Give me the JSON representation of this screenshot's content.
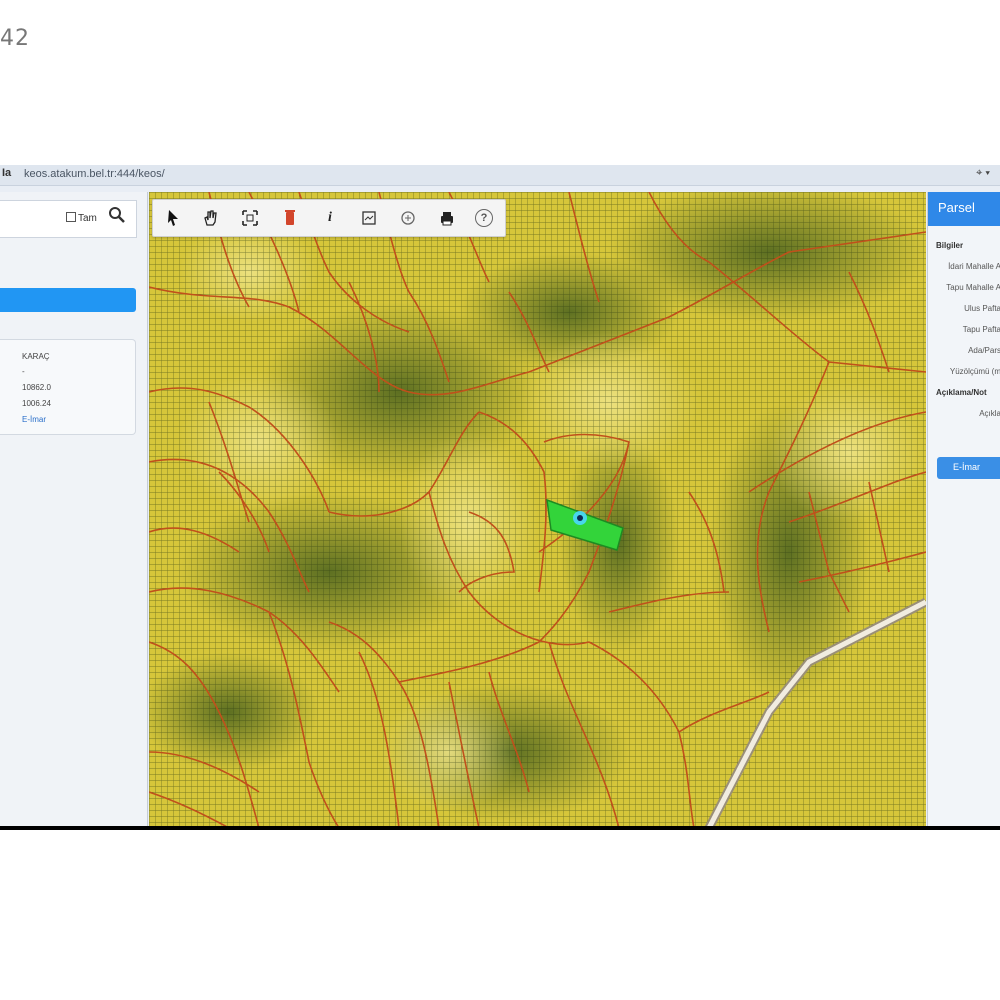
{
  "corner_number": "42",
  "browser": {
    "icon": "Ia",
    "url": "keos.atakum.bel.tr:444/keos/",
    "right_icon": "⌖ ▾"
  },
  "left_panel": {
    "checkbox_label": "Tam",
    "info_lines": [
      "KARAÇ",
      "-",
      "10862.0",
      "1006.24",
      "E-İmar"
    ]
  },
  "toolbar": {
    "buttons": [
      "pointer-tool",
      "hand-tool",
      "extent-tool",
      "delete-tool",
      "info-tool",
      "layers-tool",
      "zoom-tool",
      "print-tool",
      "help-tool"
    ],
    "info_glyph": "i",
    "help_glyph": "?"
  },
  "right_panel": {
    "title": "Parsel",
    "bilgiler": "Bilgiler",
    "rows": [
      "İdari Mahalle A",
      "Tapu Mahalle A",
      "Ulus Pafta",
      "Tapu Pafta",
      "Ada/Pars",
      "Yüzölçümü (m"
    ],
    "aciklama": "Açıklama/Not",
    "aciklama_row": "Açıkla",
    "button_label": "E-İmar"
  },
  "colors": {
    "map_yellow": "#d8c83a",
    "parcel_line": "#c0501b",
    "selected_parcel": "#33d43a",
    "accent_blue": "#2f88e8"
  }
}
